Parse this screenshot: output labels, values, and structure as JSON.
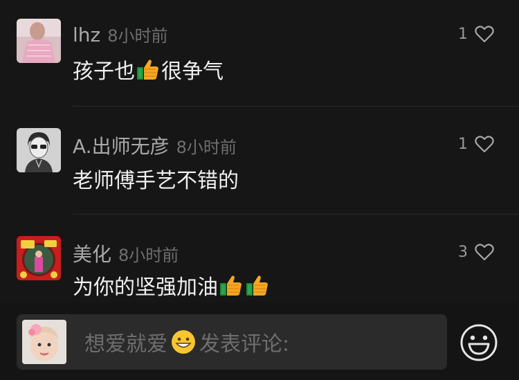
{
  "comments": [
    {
      "username": "lhz",
      "time": "8小时前",
      "text_before": "孩子也",
      "text_after": "很争气",
      "like_count": "1"
    },
    {
      "username": "A.出师无彦",
      "time": "8小时前",
      "text": "老师傅手艺不错的",
      "like_count": "1"
    },
    {
      "username": "美化",
      "time": "8小时前",
      "text": "为你的坚强加油",
      "like_count": "3"
    }
  ],
  "input": {
    "placeholder_before": "想爱就爱",
    "placeholder_after": "发表评论:"
  },
  "icons": {
    "like": "heart-outline-icon",
    "thumbs": "thumbs-up-emoji-icon",
    "emoji": "smiley-icon"
  },
  "colors": {
    "background": "#161616",
    "text": "#f0f0f0",
    "secondary": "#a9a9a9",
    "input_bg": "#2b2b2b"
  }
}
